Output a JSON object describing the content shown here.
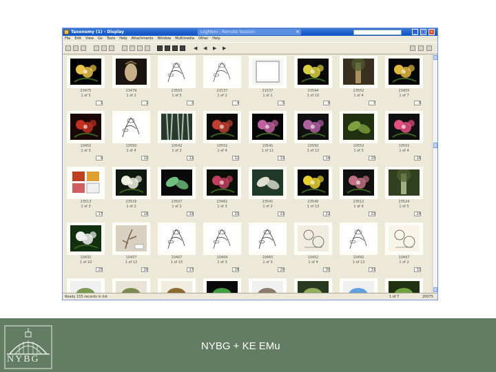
{
  "window": {
    "title": "Taxonomy (1) - Display",
    "remote_session": "LogMeIn - Remote Session",
    "close_glyph": "×",
    "min_glyph": "_",
    "max_glyph": "□",
    "win_close_glyph": "×"
  },
  "menu": [
    "File",
    "Edit",
    "View",
    "Go",
    "Tools",
    "Help",
    "Attachments",
    "Window",
    "Multimedia",
    "Other",
    "Help"
  ],
  "toolbar": {
    "nav": [
      "◀",
      "◀",
      "▶",
      "▶"
    ]
  },
  "grid": {
    "rows": [
      [
        {
          "id": "23475",
          "count": "1 of 5",
          "num": "1"
        },
        {
          "id": "23479",
          "count": "1 of 2",
          "num": "2"
        },
        {
          "id": "23503",
          "count": "1 of 5",
          "num": "3"
        },
        {
          "id": "21537",
          "count": "1 of 2",
          "num": "4"
        },
        {
          "id": "21537",
          "count": "1 of 1",
          "num": "5"
        },
        {
          "id": "23544",
          "count": "1 of 10",
          "num": "6"
        },
        {
          "id": "23552",
          "count": "1 of 4",
          "num": "7"
        },
        {
          "id": "23455",
          "count": "1 of 7",
          "num": "8"
        }
      ],
      [
        {
          "id": "10452",
          "count": "1 of 3",
          "num": "9"
        },
        {
          "id": "10550",
          "count": "1 of 4",
          "num": "10"
        },
        {
          "id": "10542",
          "count": "1 of 2",
          "num": "11"
        },
        {
          "id": "10551",
          "count": "1 of 4",
          "num": "12"
        },
        {
          "id": "10541",
          "count": "1 of 11",
          "num": "13"
        },
        {
          "id": "10550",
          "count": "1 of 12",
          "num": "14"
        },
        {
          "id": "10552",
          "count": "1 of 3",
          "num": "15"
        },
        {
          "id": "10551",
          "count": "1 of 4",
          "num": "16"
        }
      ],
      [
        {
          "id": "23513",
          "count": "1 of 3",
          "num": "17"
        },
        {
          "id": "23516",
          "count": "1 of 2",
          "num": "18"
        },
        {
          "id": "23507",
          "count": "1 of 2",
          "num": "19"
        },
        {
          "id": "23461",
          "count": "1 of 3",
          "num": "20"
        },
        {
          "id": "23541",
          "count": "1 of 2",
          "num": "21"
        },
        {
          "id": "23540",
          "count": "1 of 13",
          "num": "22"
        },
        {
          "id": "23512",
          "count": "1 of 4",
          "num": "23"
        },
        {
          "id": "23524",
          "count": "1 of 5",
          "num": "24"
        }
      ],
      [
        {
          "id": "10432",
          "count": "1 of 10",
          "num": "25"
        },
        {
          "id": "10457",
          "count": "1 of 12",
          "num": "26"
        },
        {
          "id": "10467",
          "count": "1 of 15",
          "num": "27"
        },
        {
          "id": "10464",
          "count": "1 of 3",
          "num": "28"
        },
        {
          "id": "10465",
          "count": "1 of 3",
          "num": "29"
        },
        {
          "id": "10452",
          "count": "1 of 4",
          "num": "30"
        },
        {
          "id": "10492",
          "count": "1 of 13",
          "num": "31"
        },
        {
          "id": "10497",
          "count": "1 of 2",
          "num": "32"
        }
      ]
    ]
  },
  "status": {
    "left": "Ready  155 records in list",
    "count": "1 of 7",
    "total": "20075"
  },
  "footer": {
    "title": "NYBG + KE EMu",
    "logo_text": "NYBG"
  },
  "colors": {
    "footer": "#627d62",
    "titlebar": "#0b4fc6"
  }
}
